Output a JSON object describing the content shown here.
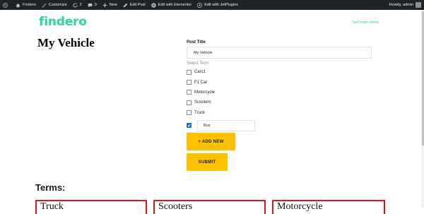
{
  "adminbar": {
    "items": [
      {
        "icon": "wordpress-icon",
        "label": ""
      },
      {
        "icon": "home-icon",
        "label": "Findero"
      },
      {
        "icon": "brush-icon",
        "label": "Customize"
      },
      {
        "icon": "updates-icon",
        "label": "2"
      },
      {
        "icon": "comment-icon",
        "label": "0"
      },
      {
        "icon": "plus-icon",
        "label": "New"
      },
      {
        "icon": "pencil-icon",
        "label": "Edit Post"
      },
      {
        "icon": "elementor-icon",
        "label": "Edit with Elementor"
      },
      {
        "icon": "jetplugins-icon",
        "label": "Edit with JetPlugins"
      }
    ],
    "user_greeting": "Howdy, admin"
  },
  "site": {
    "logo": "findero",
    "menu_link": "Set main menu",
    "brand_color": "#2ed39b"
  },
  "page": {
    "title": "My Vehicle"
  },
  "form": {
    "post_title_label": "Post Title",
    "post_title_value": "My Vehicle",
    "select_term_label": "Select Term",
    "terms": [
      "Cars1",
      "F1 Car",
      "Motorcycle",
      "Scooters",
      "Truck"
    ],
    "new_term_checked": true,
    "new_term_value": "Bus",
    "add_new_label": "+ ADD NEW",
    "submit_label": "SUBMIT",
    "button_color": "#fcc100"
  },
  "terms_section": {
    "heading": "Terms:",
    "cards": [
      "Truck",
      "Scooters",
      "Motorcycle"
    ],
    "card_border_color": "#e3131c"
  }
}
